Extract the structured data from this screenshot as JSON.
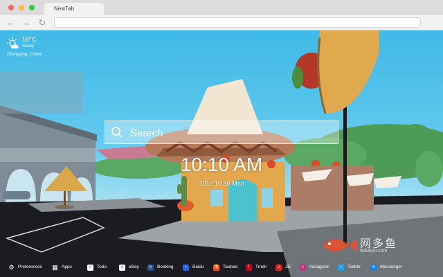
{
  "browser": {
    "tab_title": "NewTab"
  },
  "weather": {
    "temperature": "16°C",
    "condition": "Sunny",
    "location": "Chongqing , China"
  },
  "search": {
    "placeholder": "Search"
  },
  "clock": {
    "time": "10:10 AM",
    "date": "2017.10.30 Mon"
  },
  "watermark": {
    "text": "网多鱼",
    "subtext": "wduoyu.com"
  },
  "bottom_bar": {
    "items": [
      {
        "label": "Preferences",
        "icon": "gear-icon",
        "color": "#333333"
      },
      {
        "label": "Apps",
        "icon": "grid-icon",
        "color": "#333333"
      },
      {
        "label": "Todo",
        "icon": "checkbox-icon",
        "color": "#ffffff"
      },
      {
        "label": "eBay",
        "icon": "ebay-icon",
        "color": "#ffffff"
      },
      {
        "label": "Booking",
        "icon": "booking-icon",
        "color": "#1e4fa3"
      },
      {
        "label": "Baidu",
        "icon": "baidu-icon",
        "color": "#2a66d9"
      },
      {
        "label": "Taobao",
        "icon": "taobao-icon",
        "color": "#ff5000"
      },
      {
        "label": "Tmall",
        "icon": "tmall-icon",
        "color": "#d0021b"
      },
      {
        "label": "JD",
        "icon": "jd-icon",
        "color": "#e1251b"
      },
      {
        "label": "Instagram",
        "icon": "instagram-icon",
        "color": "#c13584"
      },
      {
        "label": "Twitter",
        "icon": "twitter-icon",
        "color": "#1da1f2"
      },
      {
        "label": "Messenger",
        "icon": "messenger-icon",
        "color": "#0084ff"
      }
    ]
  }
}
